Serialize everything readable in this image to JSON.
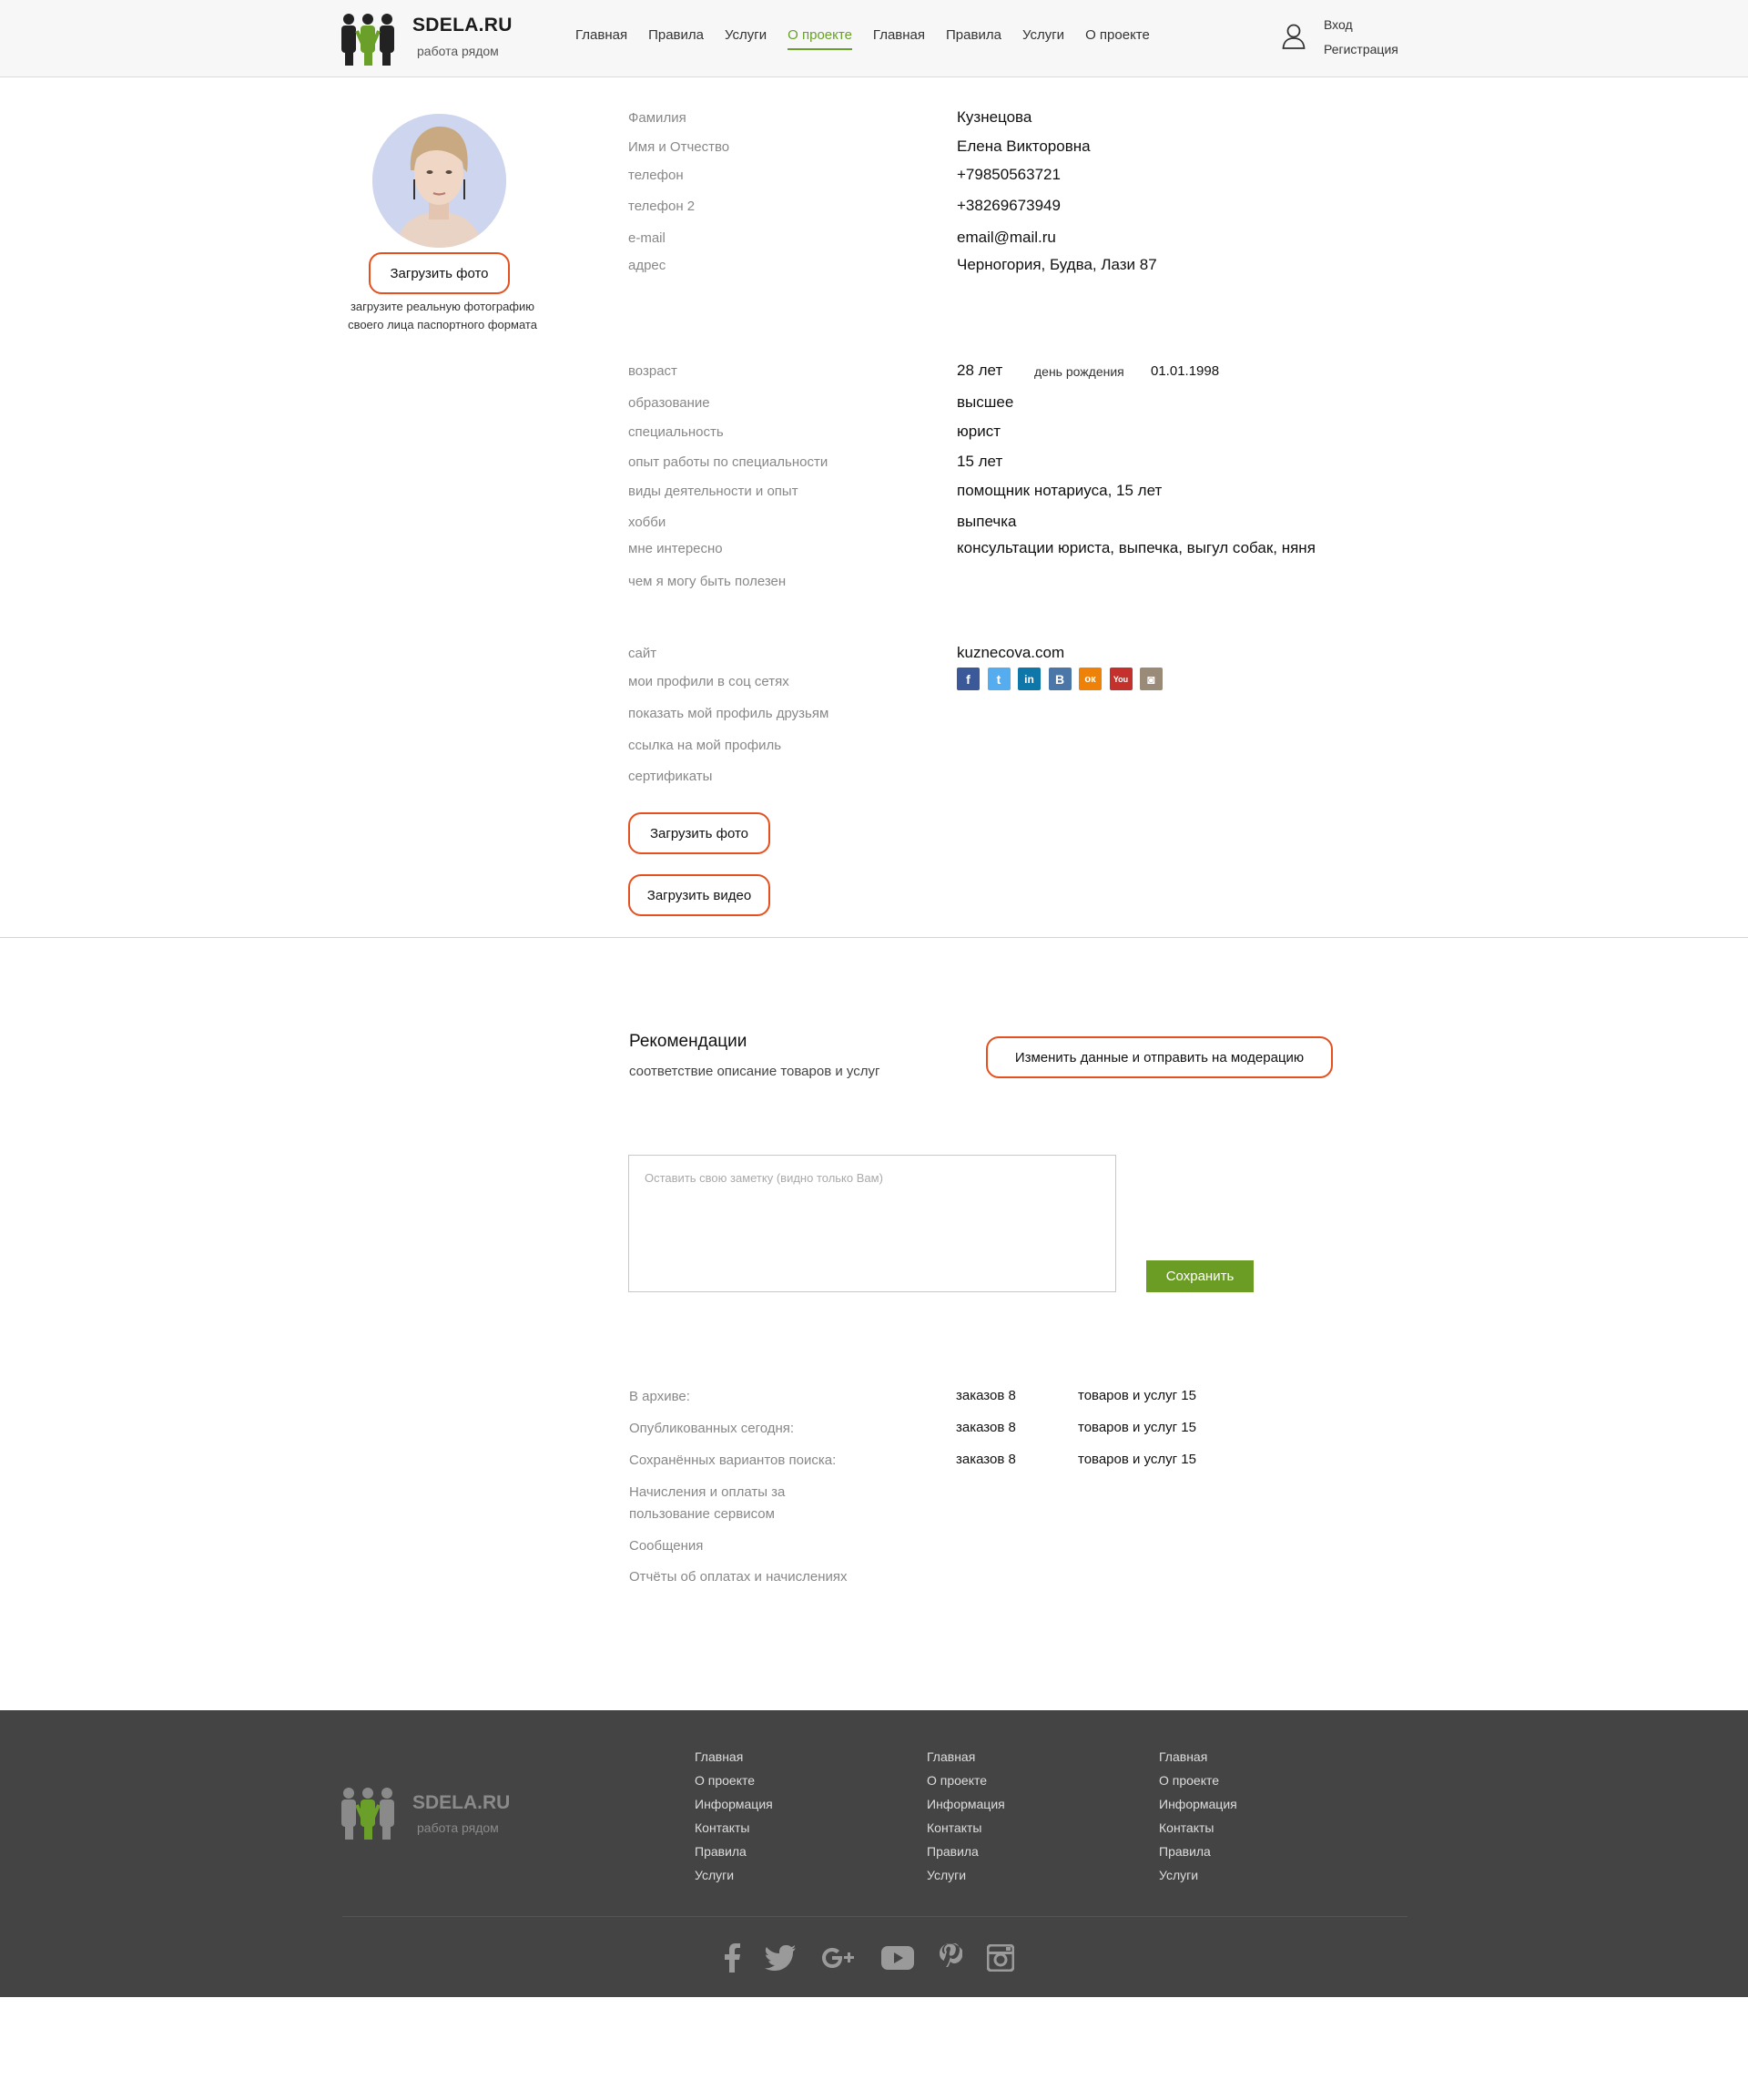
{
  "brand": {
    "name": "SDELA.RU",
    "tagline": "работа рядом",
    "accent": "#6a9f2a",
    "button_border": "#e5501f",
    "save_color": "#6b9c23"
  },
  "nav": {
    "items": [
      {
        "label": "Главная",
        "active": false
      },
      {
        "label": "Правила",
        "active": false
      },
      {
        "label": "Услуги",
        "active": false
      },
      {
        "label": "О проекте",
        "active": true
      },
      {
        "label": "Главная",
        "active": false
      },
      {
        "label": "Правила",
        "active": false
      },
      {
        "label": "Услуги",
        "active": false
      },
      {
        "label": "О проекте",
        "active": false
      }
    ]
  },
  "auth": {
    "login": "Вход",
    "register": "Регистрация",
    "icon": "user-icon"
  },
  "profile": {
    "upload_photo": "Загрузить фото",
    "upload_hint": "загрузите реальную фотографию своего лица паспортного формата",
    "fields": {
      "lastname": {
        "label": "Фамилия",
        "value": "Кузнецова"
      },
      "name": {
        "label": "Имя и Отчество",
        "value": "Елена Викторовна"
      },
      "phone": {
        "label": "телефон",
        "value": "+79850563721"
      },
      "phone2": {
        "label": "телефон 2",
        "value": "+38269673949"
      },
      "email": {
        "label": "e-mail",
        "value": "email@mail.ru"
      },
      "address": {
        "label": "адрес",
        "value": "Черногория, Будва, Лази 87"
      },
      "age": {
        "label": "возраст",
        "value": "28 лет",
        "birthday_label": "день рождения",
        "birthday": "01.01.1998"
      },
      "education": {
        "label": "образование",
        "value": "высшее"
      },
      "specialty": {
        "label": "специальность",
        "value": "юрист"
      },
      "experience": {
        "label": "опыт работы по специальности",
        "value": "15 лет"
      },
      "activities": {
        "label": "виды деятельности и опыт",
        "value": "помощник нотариуса, 15 лет"
      },
      "hobby": {
        "label": "хобби",
        "value": "выпечка"
      },
      "interests": {
        "label": "мне интересно",
        "value": "консультации юриста, выпечка, выгул собак, няня"
      },
      "useful": {
        "label": "чем я могу быть полезен"
      },
      "site": {
        "label": "сайт",
        "value": "kuznecova.com"
      },
      "socials": {
        "label": "мои профили в соц сетях"
      },
      "show_friends": {
        "label": "показать мой профиль друзьям"
      },
      "profile_link": {
        "label": "ссылка на мой профиль"
      },
      "certificates": {
        "label": "сертификаты"
      }
    },
    "social_icons": [
      {
        "icon": "facebook-icon",
        "glyph": "f",
        "color": "#3b5998"
      },
      {
        "icon": "twitter-icon",
        "glyph": "t",
        "color": "#55acee"
      },
      {
        "icon": "linkedin-icon",
        "glyph": "in",
        "color": "#0e76a8"
      },
      {
        "icon": "vk-icon",
        "glyph": "В",
        "color": "#4a76a8"
      },
      {
        "icon": "odnoklassniki-icon",
        "glyph": "ок",
        "color": "#ee8208"
      },
      {
        "icon": "youtube-icon",
        "glyph": "You",
        "color": "#c4302b"
      },
      {
        "icon": "instagram-icon",
        "glyph": "◙",
        "color": "#9a8a78"
      }
    ],
    "upload_photo_2": "Загрузить фото",
    "upload_video": "Загрузить видео"
  },
  "recommendations": {
    "title": "Рекомендации",
    "subtitle": "соответствие описание товаров и услуг",
    "moderation_button": "Изменить данные и отправить на модерацию",
    "note_placeholder": "Оставить свою заметку (видно только Вам)",
    "save_button": "Сохранить"
  },
  "stats": {
    "rows": [
      {
        "label": "В архиве:",
        "orders": "заказов 8",
        "goods": "товаров и услуг 15"
      },
      {
        "label": "Опубликованных сегодня:",
        "orders": "заказов 8",
        "goods": "товаров и услуг 15"
      },
      {
        "label": "Сохранённых вариантов поиска:",
        "orders": "заказов 8",
        "goods": "товаров и услуг 15"
      }
    ],
    "links": [
      "Начисления и оплаты за пользование сервисом",
      "Сообщения",
      "Отчёты об оплатах и начислениях"
    ]
  },
  "footer": {
    "brand": "SDELA.RU",
    "tagline": "работа рядом",
    "columns": [
      [
        "Главная",
        "О проекте",
        "Информация",
        "Контакты",
        "Правила",
        "Услуги"
      ],
      [
        "Главная",
        "О проекте",
        "Информация",
        "Контакты",
        "Правила",
        "Услуги"
      ],
      [
        "Главная",
        "О проекте",
        "Информация",
        "Контакты",
        "Правила",
        "Услуги"
      ]
    ],
    "social_icons": [
      "facebook-icon",
      "twitter-icon",
      "google-plus-icon",
      "youtube-icon",
      "pinterest-icon",
      "instagram-icon"
    ]
  }
}
